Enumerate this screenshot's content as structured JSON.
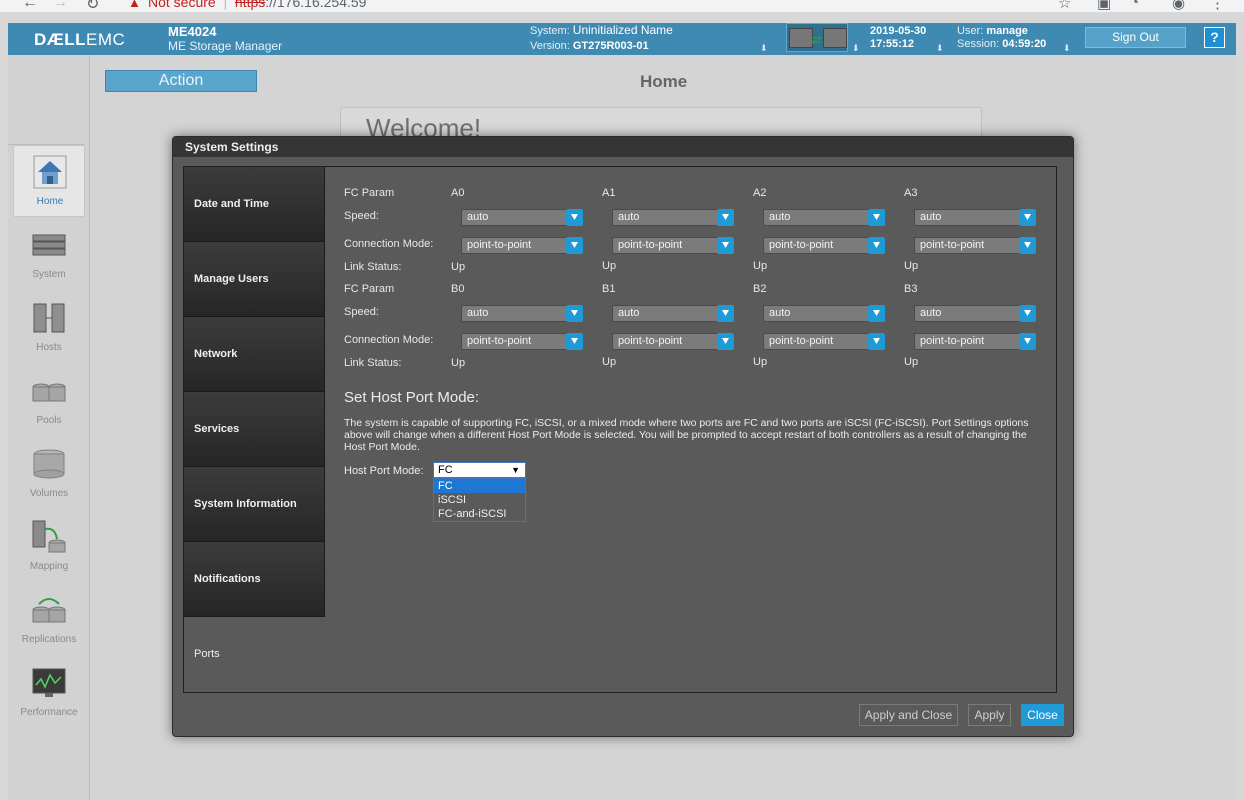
{
  "browser": {
    "security_label": "Not secure",
    "url_scheme": "https",
    "url_rest": "://176.16.254.59"
  },
  "header": {
    "logo_bold": "DÆLL",
    "logo_rest": "EMC",
    "product_name": "ME4024",
    "product_sub": "ME Storage Manager",
    "system_label": "System:",
    "system_value": "Uninitialized Name",
    "version_label": "Version:",
    "version_value": "GT275R003-01",
    "date": "2019-05-30",
    "time": "17:55:12",
    "user_label": "User:",
    "user_value": "manage",
    "session_label": "Session:",
    "session_value": "04:59:20",
    "sign_out": "Sign Out",
    "help": "?"
  },
  "nav": {
    "items": [
      {
        "label": "Home",
        "icon": "home-icon"
      },
      {
        "label": "System",
        "icon": "system-icon"
      },
      {
        "label": "Hosts",
        "icon": "hosts-icon"
      },
      {
        "label": "Pools",
        "icon": "pools-icon"
      },
      {
        "label": "Volumes",
        "icon": "volumes-icon"
      },
      {
        "label": "Mapping",
        "icon": "mapping-icon"
      },
      {
        "label": "Replications",
        "icon": "replications-icon"
      },
      {
        "label": "Performance",
        "icon": "performance-icon"
      }
    ]
  },
  "main": {
    "action_label": "Action",
    "page_title": "Home",
    "welcome": "Welcome!"
  },
  "modal": {
    "title": "System Settings",
    "tabs": [
      "Date and Time",
      "Manage Users",
      "Network",
      "Services",
      "System Information",
      "Notifications",
      "Ports"
    ],
    "selected_tab": "Ports",
    "labels": {
      "fc_param": "FC Param",
      "speed": "Speed:",
      "connection_mode": "Connection Mode:",
      "link_status": "Link Status:"
    },
    "groups": [
      {
        "ports": [
          {
            "name": "A0",
            "speed": "auto",
            "mode": "point-to-point",
            "status": "Up"
          },
          {
            "name": "A1",
            "speed": "auto",
            "mode": "point-to-point",
            "status": "Up"
          },
          {
            "name": "A2",
            "speed": "auto",
            "mode": "point-to-point",
            "status": "Up"
          },
          {
            "name": "A3",
            "speed": "auto",
            "mode": "point-to-point",
            "status": "Up"
          }
        ]
      },
      {
        "ports": [
          {
            "name": "B0",
            "speed": "auto",
            "mode": "point-to-point",
            "status": "Up"
          },
          {
            "name": "B1",
            "speed": "auto",
            "mode": "point-to-point",
            "status": "Up"
          },
          {
            "name": "B2",
            "speed": "auto",
            "mode": "point-to-point",
            "status": "Up"
          },
          {
            "name": "B3",
            "speed": "auto",
            "mode": "point-to-point",
            "status": "Up"
          }
        ]
      }
    ],
    "host_port_section_title": "Set Host Port Mode:",
    "host_port_description": "The system is capable of supporting FC, iSCSI, or a mixed mode where two ports are FC and two ports are iSCSI (FC-iSCSI). Port Settings options above will change when a different Host Port Mode is selected. You will be prompted to accept restart of both controllers as a result of changing the Host Port Mode.",
    "host_port_mode_label": "Host Port Mode:",
    "host_port_mode_value": "FC",
    "host_port_mode_options": [
      "FC",
      "iSCSI",
      "FC-and-iSCSI"
    ],
    "buttons": {
      "apply_close": "Apply and Close",
      "apply": "Apply",
      "close": "Close"
    }
  },
  "colors": {
    "header_bg": "#3e8ab2",
    "accent": "#1f9ad6",
    "modal_bg": "#5a5a5a"
  }
}
